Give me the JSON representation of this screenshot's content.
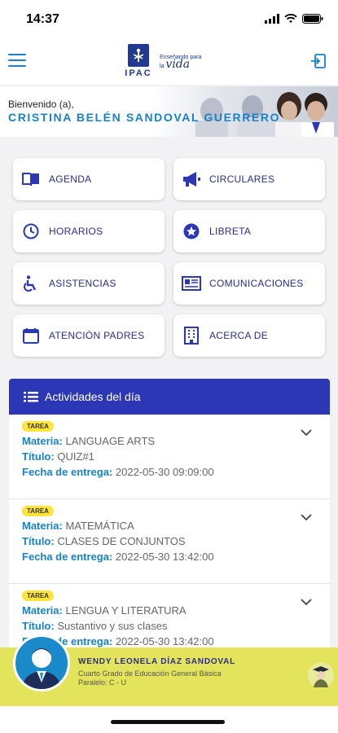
{
  "status_bar": {
    "time": "14:37"
  },
  "header": {
    "logo_text": "IPAC",
    "slogan_line1": "Enseñando para",
    "slogan_line2": "la",
    "slogan_word": "vida"
  },
  "welcome": {
    "label": "Bienvenido (a),",
    "name": "CRISTINA BELÉN SANDOVAL GUERRERO"
  },
  "menu": [
    {
      "label": "AGENDA",
      "icon": "book-icon"
    },
    {
      "label": "CIRCULARES",
      "icon": "megaphone-icon"
    },
    {
      "label": "HORARIOS",
      "icon": "clock-icon"
    },
    {
      "label": "LIBRETA",
      "icon": "star-icon"
    },
    {
      "label": "ASISTENCIAS",
      "icon": "accessible-icon"
    },
    {
      "label": "COMUNICACIONES",
      "icon": "newspaper-icon"
    },
    {
      "label": "ATENCIÓN PADRES",
      "icon": "calendar-icon"
    },
    {
      "label": "ACERCA DE",
      "icon": "building-icon"
    }
  ],
  "activities": {
    "title": "Actividades del día",
    "field_labels": {
      "materia": "Materia:",
      "titulo": "Título:",
      "fecha": "Fecha de entrega:"
    },
    "items": [
      {
        "badge": "TAREA",
        "materia": "LANGUAGE ARTS",
        "titulo": "QUIZ#1",
        "fecha": "2022-05-30 09:09:00"
      },
      {
        "badge": "TAREA",
        "materia": "MATEMÁTICA",
        "titulo": "CLASES DE CONJUNTOS",
        "fecha": "2022-05-30 13:42:00"
      },
      {
        "badge": "TAREA",
        "materia": "LENGUA Y LITERATURA",
        "titulo": "Sustantivo y sus clases",
        "fecha": "2022-05-30 13:42:00"
      }
    ]
  },
  "student": {
    "name": "WENDY LEONELA DÍAZ SANDOVAL",
    "grade": "Cuarto Grado de Educación General Básica",
    "paralelo": "Paralelo: C - U"
  },
  "colors": {
    "primary": "#2b37b5",
    "accent": "#1a82c4",
    "badge": "#ffe43a",
    "footer": "#e4e45c"
  }
}
